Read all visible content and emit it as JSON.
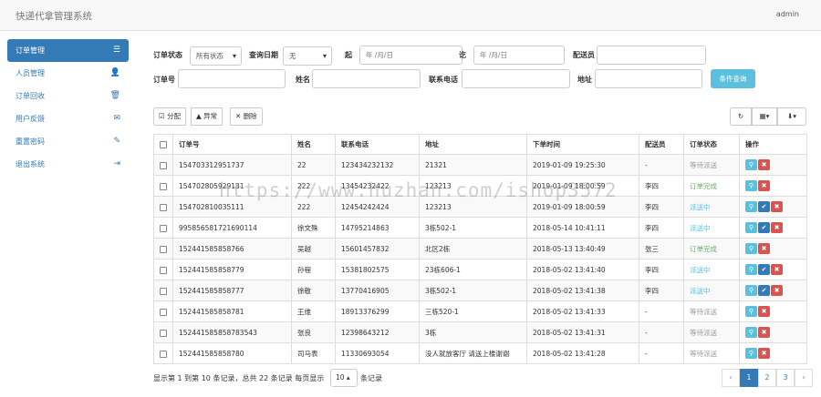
{
  "app": {
    "title": "快递代拿管理系统",
    "user": "admin"
  },
  "sidebar": {
    "items": [
      {
        "label": "订单管理",
        "icon": "list-icon"
      },
      {
        "label": "人员管理",
        "icon": "user-icon"
      },
      {
        "label": "订单回收",
        "icon": "trash-icon"
      },
      {
        "label": "用户反馈",
        "icon": "envelope-icon"
      },
      {
        "label": "重置密码",
        "icon": "pencil-icon"
      },
      {
        "label": "退出系统",
        "icon": "logout-icon"
      }
    ]
  },
  "filters": {
    "status_label": "订单状态",
    "status_value": "所有状态",
    "date_label": "查询日期",
    "date_value": "无",
    "from_label": "起",
    "from_placeholder": "年 /月/日",
    "to_label": "讫",
    "to_placeholder": "年 /月/日",
    "courier_label": "配送员",
    "order_no_label": "订单号",
    "name_label": "姓名",
    "phone_label": "联系电话",
    "address_label": "地址",
    "query_button": "条件查询"
  },
  "toolbar": {
    "assign": "分配",
    "abnormal": "异常",
    "delete": "删除"
  },
  "table": {
    "headers": [
      "订单号",
      "姓名",
      "联系电话",
      "地址",
      "下单时间",
      "配送员",
      "订单状态",
      "操作"
    ],
    "rows": [
      {
        "order": "154703312951737",
        "name": "22",
        "phone": "123434232132",
        "addr": "21321",
        "time": "2019-01-09 19:25:30",
        "courier": "-",
        "status": "等待派送",
        "st": "wait"
      },
      {
        "order": "154702805929131",
        "name": "222",
        "phone": "13454232422",
        "addr": "123213",
        "time": "2019-01-09 18:00:59",
        "courier": "李四",
        "status": "订单完成",
        "st": "done"
      },
      {
        "order": "154702810035111",
        "name": "222",
        "phone": "12454242424",
        "addr": "123213",
        "time": "2019-01-09 18:00:59",
        "courier": "李四",
        "status": "派送中",
        "st": "send"
      },
      {
        "order": "995856581721690114",
        "name": "徐文殊",
        "phone": "14795214863",
        "addr": "3栋502-1",
        "time": "2018-05-14 10:41:11",
        "courier": "李四",
        "status": "派送中",
        "st": "send"
      },
      {
        "order": "152441585858766",
        "name": "吴越",
        "phone": "15601457832",
        "addr": "北区2栋",
        "time": "2018-05-13 13:40:49",
        "courier": "张三",
        "status": "订单完成",
        "st": "done"
      },
      {
        "order": "152441585858779",
        "name": "孙程",
        "phone": "15381802575",
        "addr": "23栋606-1",
        "time": "2018-05-02 13:41:40",
        "courier": "李四",
        "status": "派送中",
        "st": "send"
      },
      {
        "order": "152441585858777",
        "name": "徐敬",
        "phone": "13770416905",
        "addr": "3栋502-1",
        "time": "2018-05-02 13:41:38",
        "courier": "李四",
        "status": "派送中",
        "st": "send"
      },
      {
        "order": "152441585858781",
        "name": "王维",
        "phone": "18913376299",
        "addr": "三栋520-1",
        "time": "2018-05-02 13:41:33",
        "courier": "-",
        "status": "等待派送",
        "st": "wait"
      },
      {
        "order": "152441585858783543",
        "name": "张良",
        "phone": "12398643212",
        "addr": "3栋",
        "time": "2018-05-02 13:41:31",
        "courier": "-",
        "status": "等待派送",
        "st": "wait"
      },
      {
        "order": "152441585858780",
        "name": "司马表",
        "phone": "11330693054",
        "addr": "没人就放客厅 请送上楼谢谢",
        "time": "2018-05-02 13:41:28",
        "courier": "-",
        "status": "等待派送",
        "st": "wait"
      }
    ]
  },
  "footer": {
    "summary": "显示第 1 到第 10 条记录，总共 22 条记录 每页显示",
    "per_page": "10",
    "per_page_suffix": "条记录"
  },
  "pagination": {
    "prev": "‹",
    "pages": [
      "1",
      "2",
      "3"
    ],
    "next": "›",
    "active": "1"
  },
  "watermark": "https://www.huzhan.com/ishop3572"
}
